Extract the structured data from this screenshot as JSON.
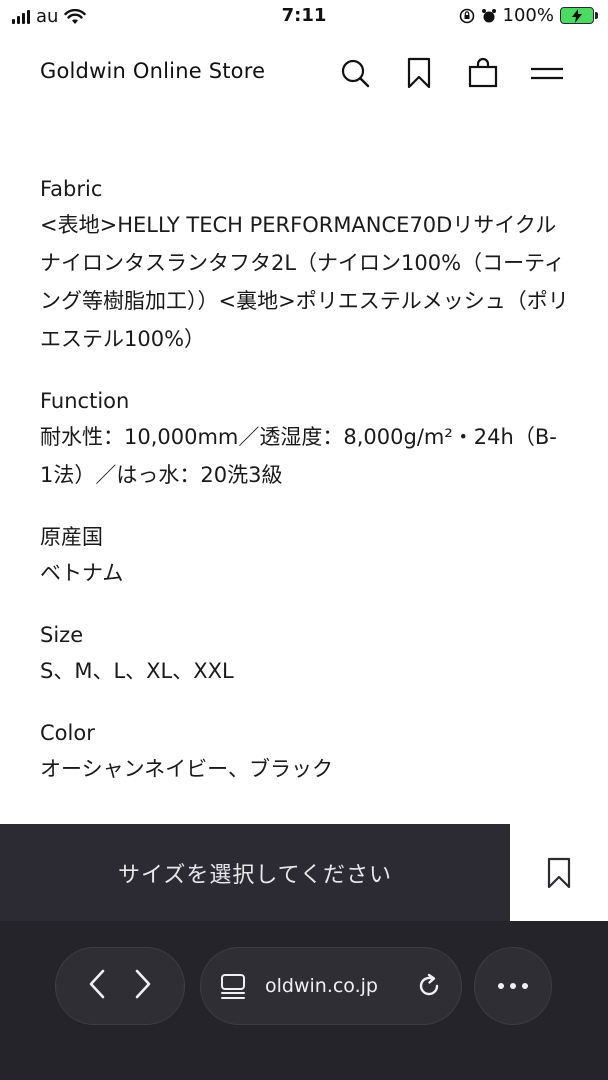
{
  "status_bar": {
    "carrier": "au",
    "time": "7:11",
    "battery": "100%"
  },
  "header": {
    "brand": "Goldwin Online Store",
    "icons": [
      "search-icon",
      "bookmark-icon",
      "shopping-bag-icon",
      "menu-icon"
    ]
  },
  "specs": [
    {
      "label": "Fabric",
      "value": "<表地>HELLY TECH PERFORMANCE70Dリサイクルナイロンタスランタフタ2L（ナイロン100%（コーティング等樹脂加工））<裏地>ポリエステルメッシュ（ポリエステル100%）"
    },
    {
      "label": "Function",
      "value": "耐水性：10,000mm／透湿度：8,000g/m²・24h（B-1法）／はっ水：20洗3級"
    },
    {
      "label": "原産国",
      "value": "ベトナム"
    },
    {
      "label": "Size",
      "value": "S、M、L、XL、XXL"
    },
    {
      "label": "Color",
      "value": "オーシャンネイビー、ブラック"
    }
  ],
  "bottom_bar": {
    "select_label": "サイズを選択してください"
  },
  "browser": {
    "url": "oldwin.co.jp"
  }
}
